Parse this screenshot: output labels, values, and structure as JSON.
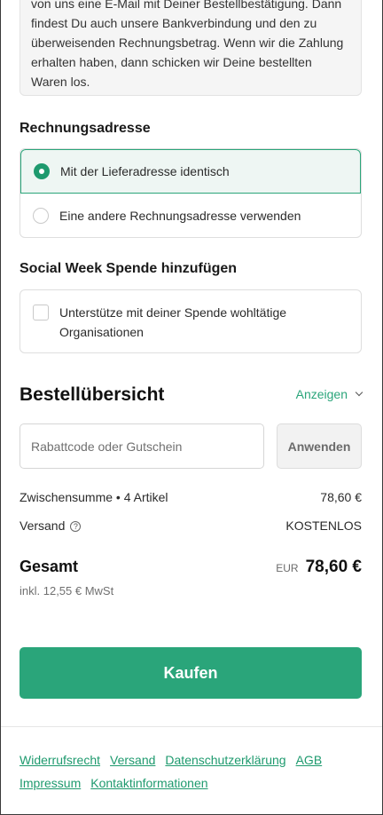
{
  "info_text": "von uns eine E-Mail mit Deiner Bestellbestätigung. Dann findest Du auch unsere Bankverbindung und den zu überweisenden Rechnungsbetrag. Wenn wir die Zahlung erhalten haben, dann schicken wir Deine bestellten Waren los.",
  "billing": {
    "title": "Rechnungsadresse",
    "options": [
      {
        "label": "Mit der Lieferadresse identisch",
        "selected": true
      },
      {
        "label": "Eine andere Rechnungsadresse verwenden",
        "selected": false
      }
    ]
  },
  "donation": {
    "title": "Social Week Spende hinzufügen",
    "checkbox_label": "Unterstütze mit deiner Spende wohltätige Organisationen",
    "checked": false
  },
  "summary": {
    "title": "Bestellübersicht",
    "toggle_label": "Anzeigen",
    "discount_placeholder": "Rabattcode oder Gutschein",
    "apply_label": "Anwenden",
    "subtotal_label": "Zwischensumme • 4 Artikel",
    "subtotal_value": "78,60 €",
    "shipping_label": "Versand",
    "shipping_value": "KOSTENLOS",
    "total_label": "Gesamt",
    "currency": "EUR",
    "total_value": "78,60 €",
    "tax_note": "inkl. 12,55 € MwSt"
  },
  "buy_label": "Kaufen",
  "footer": {
    "links": [
      "Widerrufsrecht",
      "Versand",
      "Datenschutzerklärung",
      "AGB",
      "Impressum",
      "Kontaktinformationen"
    ]
  },
  "colors": {
    "accent": "#2aa57a",
    "selected_bg": "#eef6f3"
  }
}
